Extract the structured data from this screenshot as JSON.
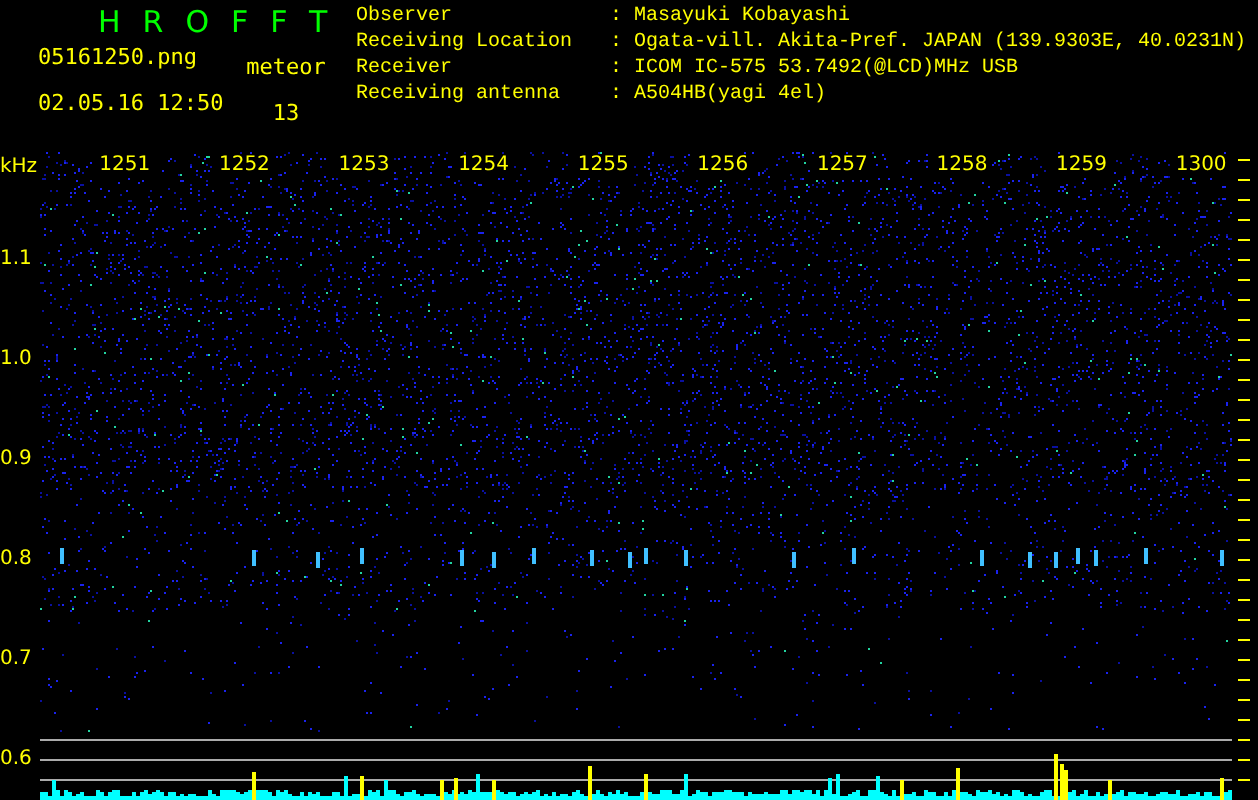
{
  "app_title": "HROFFT",
  "file_name": "05161250.png",
  "timestamp": "02.05.16 12:50",
  "meteor": {
    "label": "meteor",
    "count": "13"
  },
  "info": [
    {
      "label": "Observer",
      "value": ": Masayuki Kobayashi"
    },
    {
      "label": "Receiving Location",
      "value": ": Ogata-vill. Akita-Pref. JAPAN (139.9303E, 40.0231N)"
    },
    {
      "label": "Receiver",
      "value": ": ICOM IC-575 53.7492(@LCD)MHz USB"
    },
    {
      "label": "Receiving antenna",
      "value": ": A504HB(yagi 4el)"
    }
  ],
  "axis": {
    "unit": "kHz",
    "x_ticks": [
      "1251",
      "1252",
      "1253",
      "1254",
      "1255",
      "1256",
      "1257",
      "1258",
      "1259",
      "1300"
    ],
    "y_ticks": [
      "1.1",
      "1.0",
      "0.9",
      "0.8",
      "0.7",
      "0.6"
    ]
  }
}
